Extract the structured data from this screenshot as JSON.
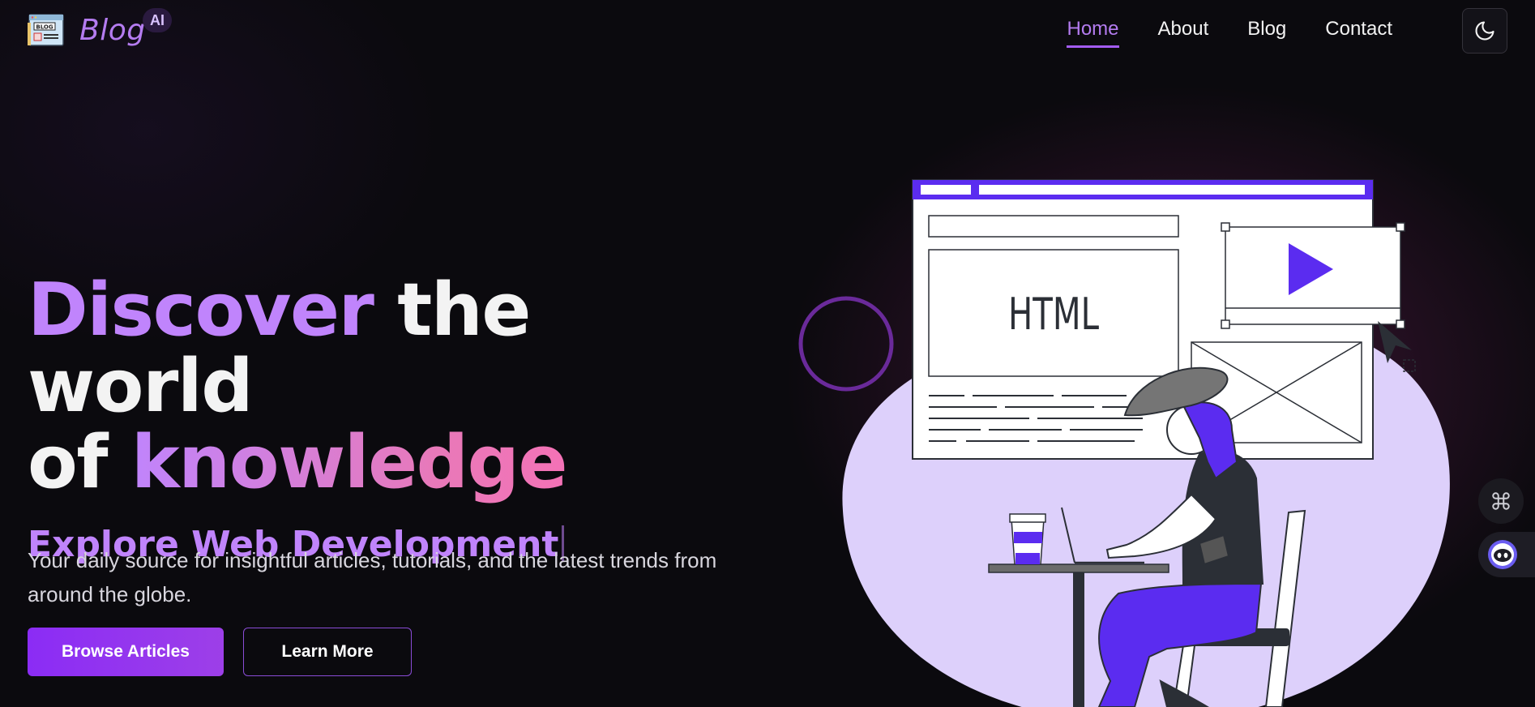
{
  "header": {
    "logo_text": "Blog",
    "logo_badge": "AI",
    "logo_icon_label": "BLOG",
    "nav": [
      {
        "label": "Home",
        "active": true
      },
      {
        "label": "About",
        "active": false
      },
      {
        "label": "Blog",
        "active": false
      },
      {
        "label": "Contact",
        "active": false
      }
    ],
    "theme_toggle_icon": "moon-icon"
  },
  "hero": {
    "headline_part1": "Discover",
    "headline_part2": " the world",
    "headline_part3": "of ",
    "headline_part4": "knowledge",
    "subtitle": "Explore Web Development",
    "description": "Your daily source for insightful articles, tutorials, and the latest trends from around the globe.",
    "primary_button": "Browse Articles",
    "secondary_button": "Learn More"
  },
  "illustration": {
    "panel_text": "HTML"
  },
  "floating": {
    "shortcut_icon": "command-icon",
    "assistant_icon": "assistant-face-icon"
  },
  "colors": {
    "accent": "#c084fc",
    "accent_pink": "#f472b6",
    "button": "#8b2cf5",
    "background": "#0b0a0e"
  }
}
